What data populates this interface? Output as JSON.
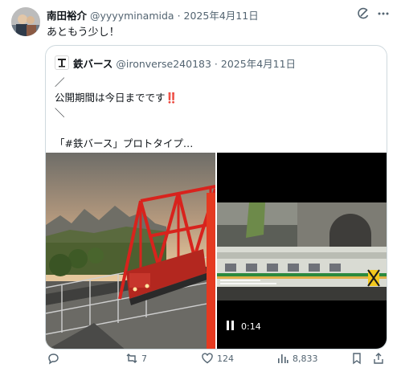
{
  "post": {
    "author_name": "南田裕介",
    "author_handle": "@yyyyminamida",
    "separator": "·",
    "date": "2025年4月11日",
    "text": "あともう少し！"
  },
  "quoted": {
    "author_name": "鉄バース",
    "author_handle": "@ironverse240183",
    "separator": "·",
    "date": "2025年4月11日",
    "line1": "／",
    "line2": "公開期間は今日までです",
    "line2_mark": "‼️",
    "line3": "＼",
    "line4": "「#鉄バース」プロトタイプ…"
  },
  "video": {
    "play_state": "pause",
    "timestamp": "0:14"
  },
  "actions": {
    "reply_count": "",
    "repost_count": "7",
    "like_count": "124",
    "views_count": "8,833"
  },
  "icons": {
    "grok": "grok-icon",
    "more": "more-icon",
    "reply": "reply-icon",
    "repost": "repost-icon",
    "like": "like-icon",
    "views": "views-icon",
    "bookmark": "bookmark-icon",
    "share": "share-icon",
    "pause": "pause-icon"
  },
  "colors": {
    "text_primary": "#0f1419",
    "text_secondary": "#536471",
    "border": "#cfd9de",
    "bridge_red": "#d8231d",
    "alert_red": "#d7193c"
  }
}
